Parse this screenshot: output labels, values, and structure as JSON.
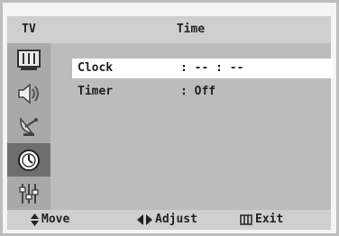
{
  "header": {
    "tv_label": "TV",
    "title": "Time"
  },
  "sidebar": {
    "items": [
      {
        "icon": "picture-icon",
        "active": false
      },
      {
        "icon": "sound-icon",
        "active": false
      },
      {
        "icon": "channel-icon",
        "active": false
      },
      {
        "icon": "clock-icon",
        "active": true
      },
      {
        "icon": "setup-icon",
        "active": false
      }
    ]
  },
  "menu": {
    "items": [
      {
        "label": "Clock",
        "value": ": -- : --",
        "selected": true
      },
      {
        "label": "Timer",
        "value": ": Off",
        "selected": false
      }
    ]
  },
  "footer": {
    "move": "Move",
    "adjust": "Adjust",
    "exit": "Exit"
  },
  "colors": {
    "selected_row": "#ffffff",
    "active_sidebar": "#6e6e6e",
    "panel": "#bcbcbc"
  }
}
